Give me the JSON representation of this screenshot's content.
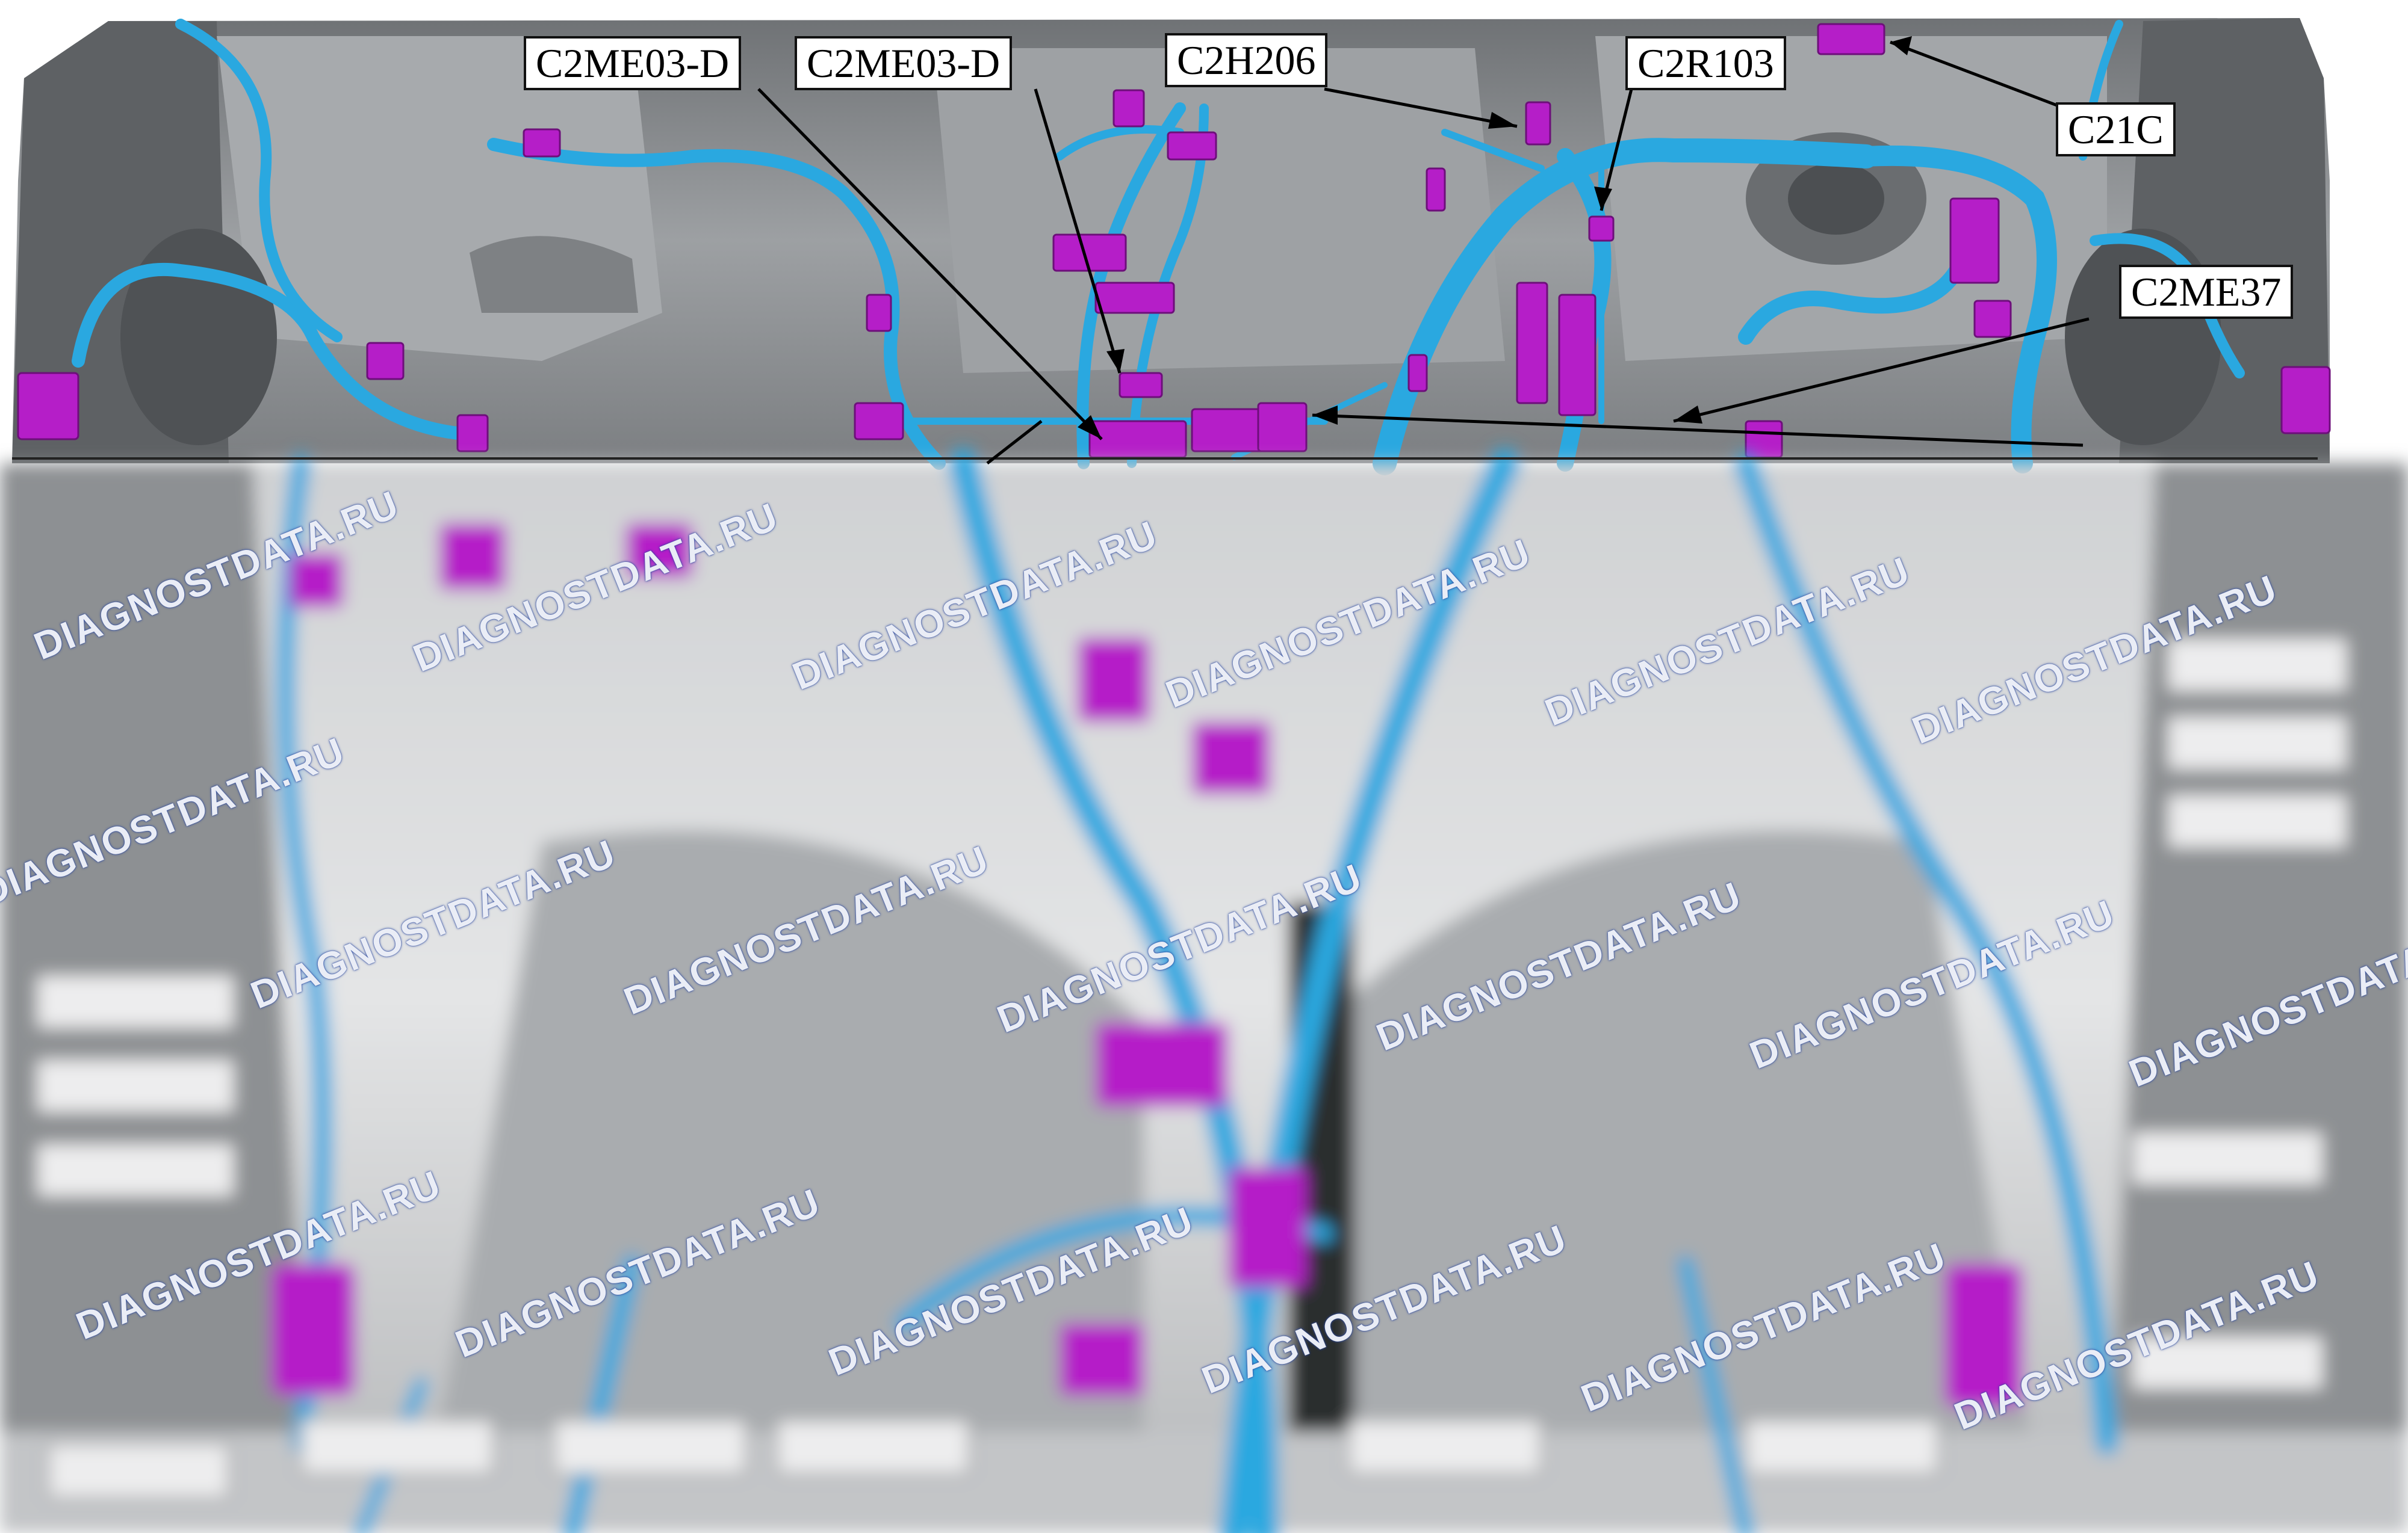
{
  "callouts": {
    "c2me03_d_1": "C2ME03-D",
    "c2me03_d_2": "C2ME03-D",
    "c2h206": "C2H206",
    "c2r103": "C2R103",
    "c21c": "C21C",
    "c2me37": "C2ME37"
  },
  "watermark": "DIAGNOSTDATA.RU",
  "colors": {
    "harness": "#2aa8e0",
    "connector": "#b51ec8",
    "body_panel": "#8a8d90",
    "background": "#ffffff"
  }
}
